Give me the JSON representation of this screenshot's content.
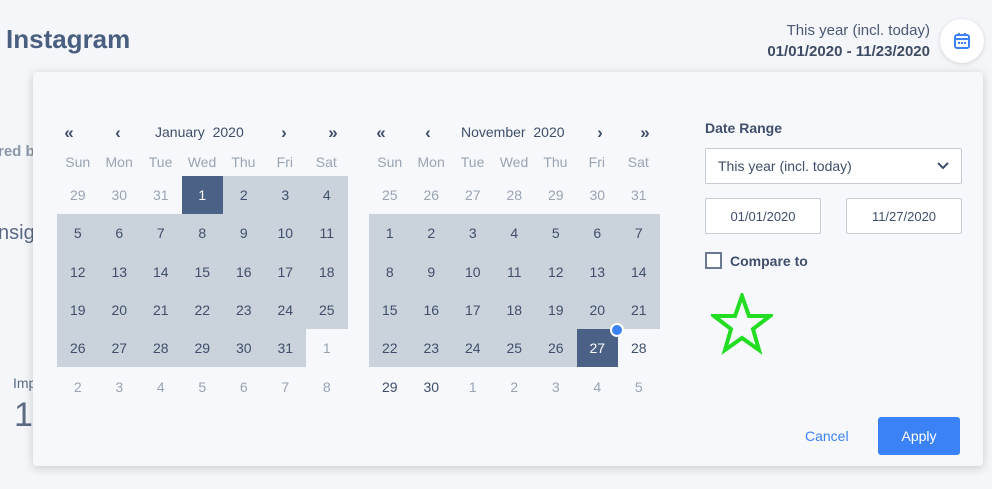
{
  "page": {
    "title": "Instagram"
  },
  "background_fragments": {
    "red_by": "red by",
    "insig": "nsig",
    "imp": "Imp",
    "digit": "1"
  },
  "range_summary": {
    "label": "This year (incl. today)",
    "dates": "01/01/2020 - 11/23/2020"
  },
  "icons": {
    "calendar": "calendar-icon",
    "first": "double-chevron-left-icon",
    "prev": "chevron-left-icon",
    "next": "chevron-right-icon",
    "last": "double-chevron-right-icon",
    "dropdown": "chevron-down-icon"
  },
  "colors": {
    "accent": "#3b82f6",
    "selected": "#4b6185",
    "range": "#cad2db",
    "highlight_star": "#22dd22"
  },
  "calendar": {
    "weekdays": [
      "Sun",
      "Mon",
      "Tue",
      "Wed",
      "Thu",
      "Fri",
      "Sat"
    ],
    "months": [
      {
        "month": "January",
        "year": "2020",
        "days": [
          {
            "d": "29",
            "s": "out"
          },
          {
            "d": "30",
            "s": "out"
          },
          {
            "d": "31",
            "s": "out"
          },
          {
            "d": "1",
            "s": "sel"
          },
          {
            "d": "2",
            "s": "inrange"
          },
          {
            "d": "3",
            "s": "inrange"
          },
          {
            "d": "4",
            "s": "inrange"
          },
          {
            "d": "5",
            "s": "inrange"
          },
          {
            "d": "6",
            "s": "inrange"
          },
          {
            "d": "7",
            "s": "inrange"
          },
          {
            "d": "8",
            "s": "inrange"
          },
          {
            "d": "9",
            "s": "inrange"
          },
          {
            "d": "10",
            "s": "inrange"
          },
          {
            "d": "11",
            "s": "inrange"
          },
          {
            "d": "12",
            "s": "inrange"
          },
          {
            "d": "13",
            "s": "inrange"
          },
          {
            "d": "14",
            "s": "inrange"
          },
          {
            "d": "15",
            "s": "inrange"
          },
          {
            "d": "16",
            "s": "inrange"
          },
          {
            "d": "17",
            "s": "inrange"
          },
          {
            "d": "18",
            "s": "inrange"
          },
          {
            "d": "19",
            "s": "inrange"
          },
          {
            "d": "20",
            "s": "inrange"
          },
          {
            "d": "21",
            "s": "inrange"
          },
          {
            "d": "22",
            "s": "inrange"
          },
          {
            "d": "23",
            "s": "inrange"
          },
          {
            "d": "24",
            "s": "inrange"
          },
          {
            "d": "25",
            "s": "inrange"
          },
          {
            "d": "26",
            "s": "inrange"
          },
          {
            "d": "27",
            "s": "inrange"
          },
          {
            "d": "28",
            "s": "inrange"
          },
          {
            "d": "29",
            "s": "inrange"
          },
          {
            "d": "30",
            "s": "inrange"
          },
          {
            "d": "31",
            "s": "inrange"
          },
          {
            "d": "1",
            "s": "out"
          },
          {
            "d": "2",
            "s": "out"
          },
          {
            "d": "3",
            "s": "out"
          },
          {
            "d": "4",
            "s": "out"
          },
          {
            "d": "5",
            "s": "out"
          },
          {
            "d": "6",
            "s": "out"
          },
          {
            "d": "7",
            "s": "out"
          },
          {
            "d": "8",
            "s": "out"
          }
        ]
      },
      {
        "month": "November",
        "year": "2020",
        "days": [
          {
            "d": "25",
            "s": "out"
          },
          {
            "d": "26",
            "s": "out"
          },
          {
            "d": "27",
            "s": "out"
          },
          {
            "d": "28",
            "s": "out"
          },
          {
            "d": "29",
            "s": "out"
          },
          {
            "d": "30",
            "s": "out"
          },
          {
            "d": "31",
            "s": "out"
          },
          {
            "d": "1",
            "s": "inrange"
          },
          {
            "d": "2",
            "s": "inrange"
          },
          {
            "d": "3",
            "s": "inrange"
          },
          {
            "d": "4",
            "s": "inrange"
          },
          {
            "d": "5",
            "s": "inrange"
          },
          {
            "d": "6",
            "s": "inrange"
          },
          {
            "d": "7",
            "s": "inrange"
          },
          {
            "d": "8",
            "s": "inrange"
          },
          {
            "d": "9",
            "s": "inrange"
          },
          {
            "d": "10",
            "s": "inrange"
          },
          {
            "d": "11",
            "s": "inrange"
          },
          {
            "d": "12",
            "s": "inrange"
          },
          {
            "d": "13",
            "s": "inrange"
          },
          {
            "d": "14",
            "s": "inrange"
          },
          {
            "d": "15",
            "s": "inrange"
          },
          {
            "d": "16",
            "s": "inrange"
          },
          {
            "d": "17",
            "s": "inrange"
          },
          {
            "d": "18",
            "s": "inrange"
          },
          {
            "d": "19",
            "s": "inrange"
          },
          {
            "d": "20",
            "s": "inrange"
          },
          {
            "d": "21",
            "s": "inrange"
          },
          {
            "d": "22",
            "s": "inrange"
          },
          {
            "d": "23",
            "s": "inrange"
          },
          {
            "d": "24",
            "s": "inrange"
          },
          {
            "d": "25",
            "s": "inrange"
          },
          {
            "d": "26",
            "s": "inrange"
          },
          {
            "d": "27",
            "s": "sel"
          },
          {
            "d": "28",
            "s": "in"
          },
          {
            "d": "29",
            "s": "in"
          },
          {
            "d": "30",
            "s": "in"
          },
          {
            "d": "1",
            "s": "out"
          },
          {
            "d": "2",
            "s": "out"
          },
          {
            "d": "3",
            "s": "out"
          },
          {
            "d": "4",
            "s": "out"
          },
          {
            "d": "5",
            "s": "out"
          }
        ]
      }
    ]
  },
  "panel": {
    "label": "Date Range",
    "select_value": "This year (incl. today)",
    "start_date": "01/01/2020",
    "end_date": "11/27/2020",
    "compare_label": "Compare to",
    "cancel_label": "Cancel",
    "apply_label": "Apply"
  }
}
